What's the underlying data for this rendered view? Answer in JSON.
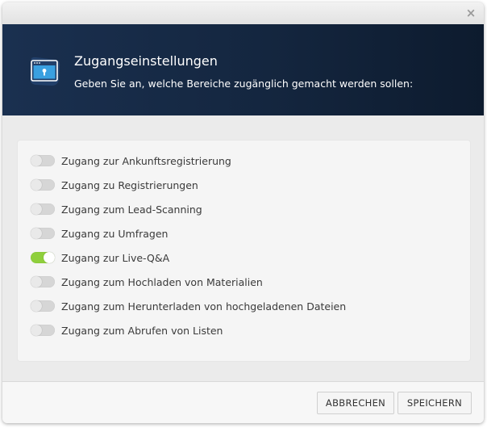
{
  "dialog": {
    "close_symbol": "×"
  },
  "header": {
    "icon": "browser-lock-icon",
    "title": "Zugangseinstellungen",
    "subtitle": "Geben Sie an, welche Bereiche zugänglich gemacht werden sollen:"
  },
  "access_toggles": [
    {
      "label": "Zugang zur Ankunftsregistrierung",
      "enabled": false
    },
    {
      "label": "Zugang zu Registrierungen",
      "enabled": false
    },
    {
      "label": "Zugang zum Lead-Scanning",
      "enabled": false
    },
    {
      "label": "Zugang zu Umfragen",
      "enabled": false
    },
    {
      "label": "Zugang zur Live-Q&A",
      "enabled": true
    },
    {
      "label": "Zugang zum Hochladen von Materialien",
      "enabled": false
    },
    {
      "label": "Zugang zum Herunterladen von hochgeladenen Dateien",
      "enabled": false
    },
    {
      "label": "Zugang zum Abrufen von Listen",
      "enabled": false
    }
  ],
  "footer": {
    "cancel_label": "ABBRECHEN",
    "save_label": "SPEICHERN"
  },
  "colors": {
    "header_background": "#14263f",
    "toggle_on": "#8fcf3c",
    "toggle_off": "#d6d6d6"
  }
}
